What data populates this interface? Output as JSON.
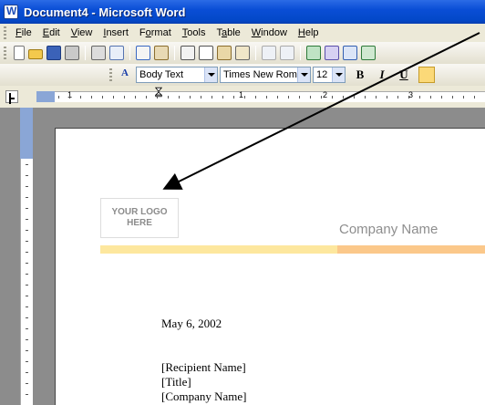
{
  "window": {
    "title": "Document4 - Microsoft Word"
  },
  "menu": [
    {
      "pre": "",
      "u": "F",
      "post": "ile"
    },
    {
      "pre": "",
      "u": "E",
      "post": "dit"
    },
    {
      "pre": "",
      "u": "V",
      "post": "iew"
    },
    {
      "pre": "",
      "u": "I",
      "post": "nsert"
    },
    {
      "pre": "F",
      "u": "o",
      "post": "rmat"
    },
    {
      "pre": "",
      "u": "T",
      "post": "ools"
    },
    {
      "pre": "T",
      "u": "a",
      "post": "ble"
    },
    {
      "pre": "",
      "u": "W",
      "post": "indow"
    },
    {
      "pre": "",
      "u": "H",
      "post": "elp"
    }
  ],
  "formatting": {
    "style": "Body Text",
    "font": "Times New Roman",
    "size": "12",
    "bold": "B",
    "italic": "I",
    "underline": "U"
  },
  "ruler": {
    "numbers": [
      "1",
      "1",
      "2",
      "3"
    ]
  },
  "document": {
    "logo_line1": "YOUR LOGO",
    "logo_line2": "HERE",
    "company_name": "Company Name",
    "date": "May 6, 2002",
    "recipient_name": "[Recipient Name]",
    "recipient_title": "[Title]",
    "company_placeholder": "[Company Name]"
  },
  "colors": {
    "titlebar": "#0a4ed6",
    "bar_left": "#fde79e",
    "bar_right": "#fbc88a",
    "arrow": "#000000"
  }
}
